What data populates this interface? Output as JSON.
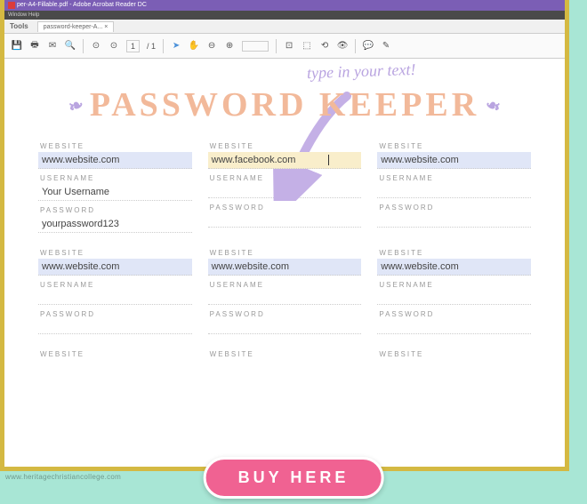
{
  "titlebar": "per-A4-Fillable.pdf - Adobe Acrobat Reader DC",
  "menubar": "Window   Help",
  "tabrow": {
    "tools": "Tools",
    "tab": "password-keeper-A... ×"
  },
  "toolbar": {
    "page_current": "1",
    "page_total": "/ 1",
    "zoom": ""
  },
  "hint": "type in your text!",
  "doc_title": "PASSWORD KEEPER",
  "labels": {
    "website": "WEBSITE",
    "username": "USERNAME",
    "password": "PASSWORD"
  },
  "cells": [
    {
      "website": "www.website.com",
      "username": "Your Username",
      "password": "yourpassword123",
      "hl": "blue"
    },
    {
      "website": "www.facebook.com",
      "username": "",
      "password": "",
      "hl": "yellow"
    },
    {
      "website": "www.website.com",
      "username": "",
      "password": "",
      "hl": "blue"
    },
    {
      "website": "www.website.com",
      "username": "",
      "password": "",
      "hl": "blue"
    },
    {
      "website": "www.website.com",
      "username": "",
      "password": "",
      "hl": "blue"
    },
    {
      "website": "www.website.com",
      "username": "",
      "password": "",
      "hl": "blue"
    },
    {
      "website": "",
      "username": null,
      "password": null,
      "hl": ""
    },
    {
      "website": "",
      "username": null,
      "password": null,
      "hl": ""
    },
    {
      "website": "",
      "username": null,
      "password": null,
      "hl": ""
    }
  ],
  "watermark": "www.heritagechristiancollege.com",
  "buy": "BUY HERE"
}
